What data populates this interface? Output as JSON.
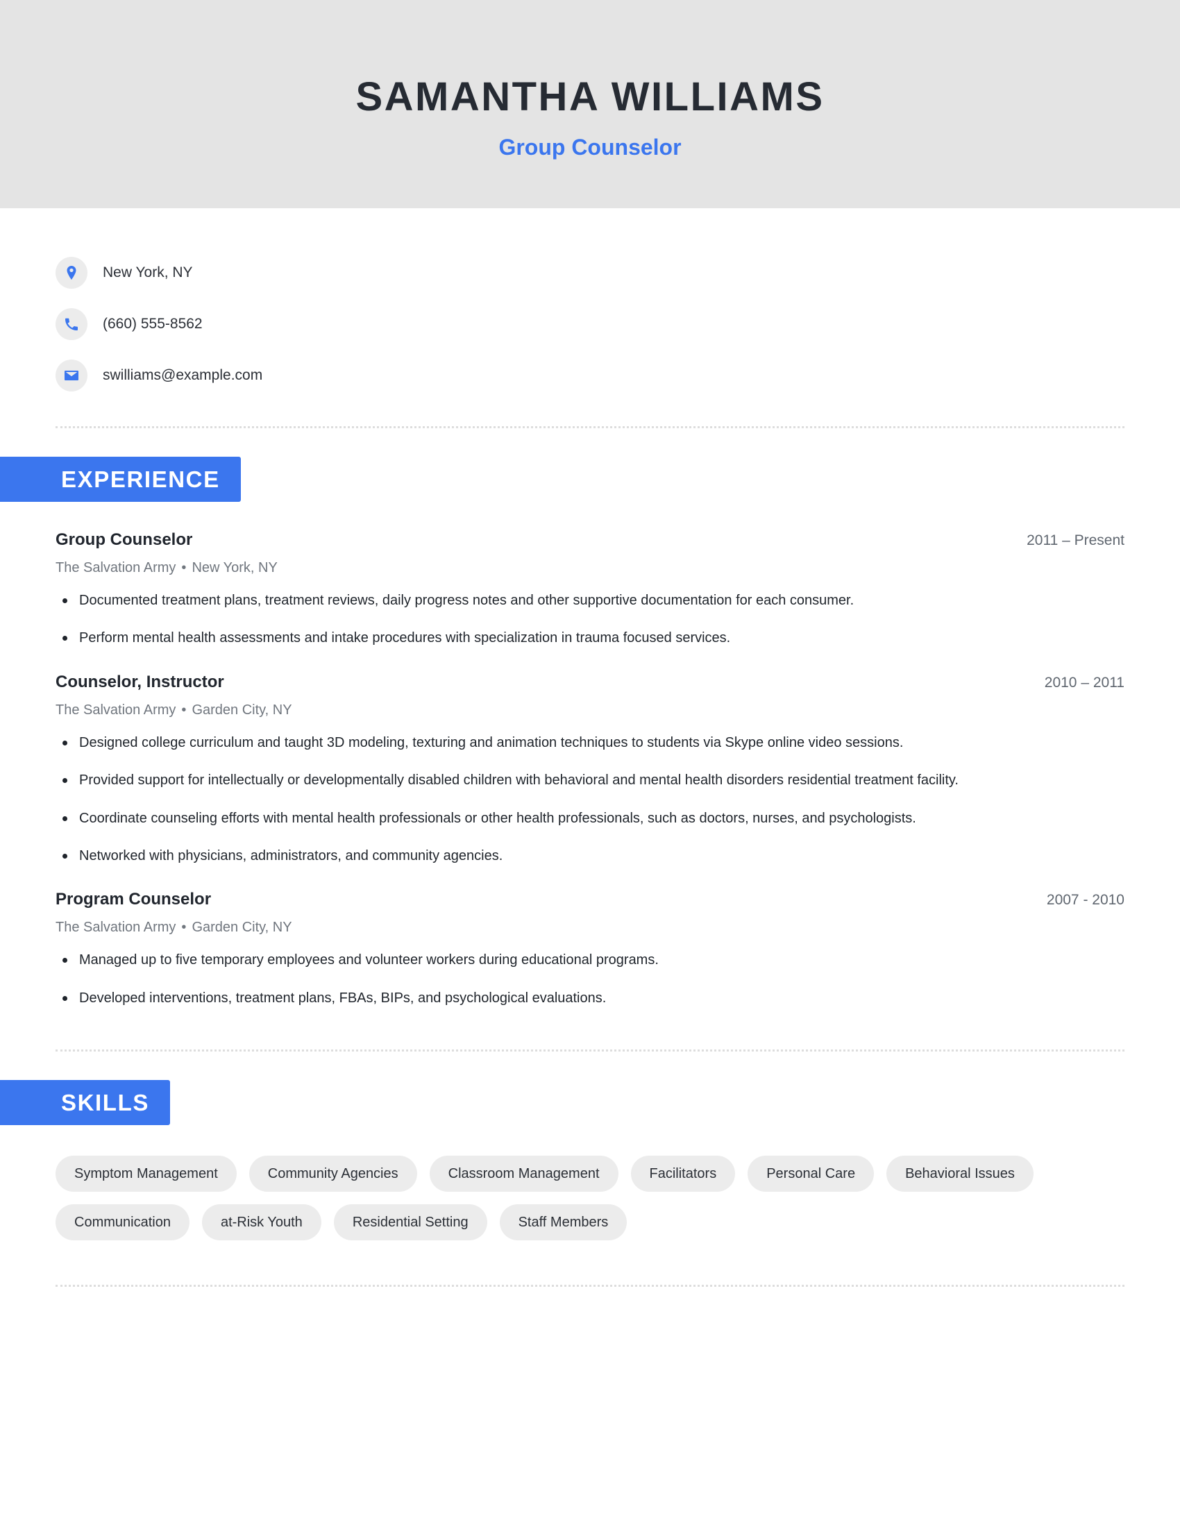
{
  "header": {
    "name": "SAMANTHA WILLIAMS",
    "job_title": "Group Counselor",
    "background_color": "#e4e4e4",
    "accent_color": "#3b76ee"
  },
  "contact": {
    "location": "New York, NY",
    "phone": "(660) 555-8562",
    "email": "swilliams@example.com",
    "icons": {
      "location": "map-pin-icon",
      "phone": "phone-icon",
      "email": "envelope-icon"
    }
  },
  "sections": {
    "experience_label": "EXPERIENCE",
    "skills_label": "SKILLS"
  },
  "experience": [
    {
      "role": "Group Counselor",
      "company": "The Salvation Army",
      "separator": "•",
      "location": "New York, NY",
      "dates": "2011 – Present",
      "bullets": [
        "Documented treatment plans, treatment reviews, daily progress notes and other supportive documentation for each consumer.",
        "Perform mental health assessments and intake procedures with specialization in trauma focused services."
      ]
    },
    {
      "role": "Counselor, Instructor",
      "company": "The Salvation Army",
      "separator": "•",
      "location": "Garden City, NY",
      "dates": "2010 – 2011",
      "bullets": [
        "Designed college curriculum and taught 3D modeling, texturing and animation techniques to students via Skype online video sessions.",
        "Provided support for intellectually or developmentally disabled children with behavioral and mental health disorders residential treatment facility.",
        "Coordinate counseling efforts with mental health professionals or other health professionals, such as doctors, nurses, and psychologists.",
        "Networked with physicians, administrators, and community agencies."
      ]
    },
    {
      "role": "Program Counselor",
      "company": "The Salvation Army",
      "separator": "•",
      "location": "Garden City, NY",
      "dates": "2007 - 2010",
      "bullets": [
        "Managed up to five temporary employees and volunteer workers during educational programs.",
        "Developed interventions, treatment plans, FBAs, BIPs, and psychological evaluations."
      ]
    }
  ],
  "skills": [
    "Symptom Management",
    "Community Agencies",
    "Classroom Management",
    "Facilitators",
    "Personal Care",
    "Behavioral Issues",
    "Communication",
    "at-Risk Youth",
    "Residential Setting",
    "Staff Members"
  ]
}
